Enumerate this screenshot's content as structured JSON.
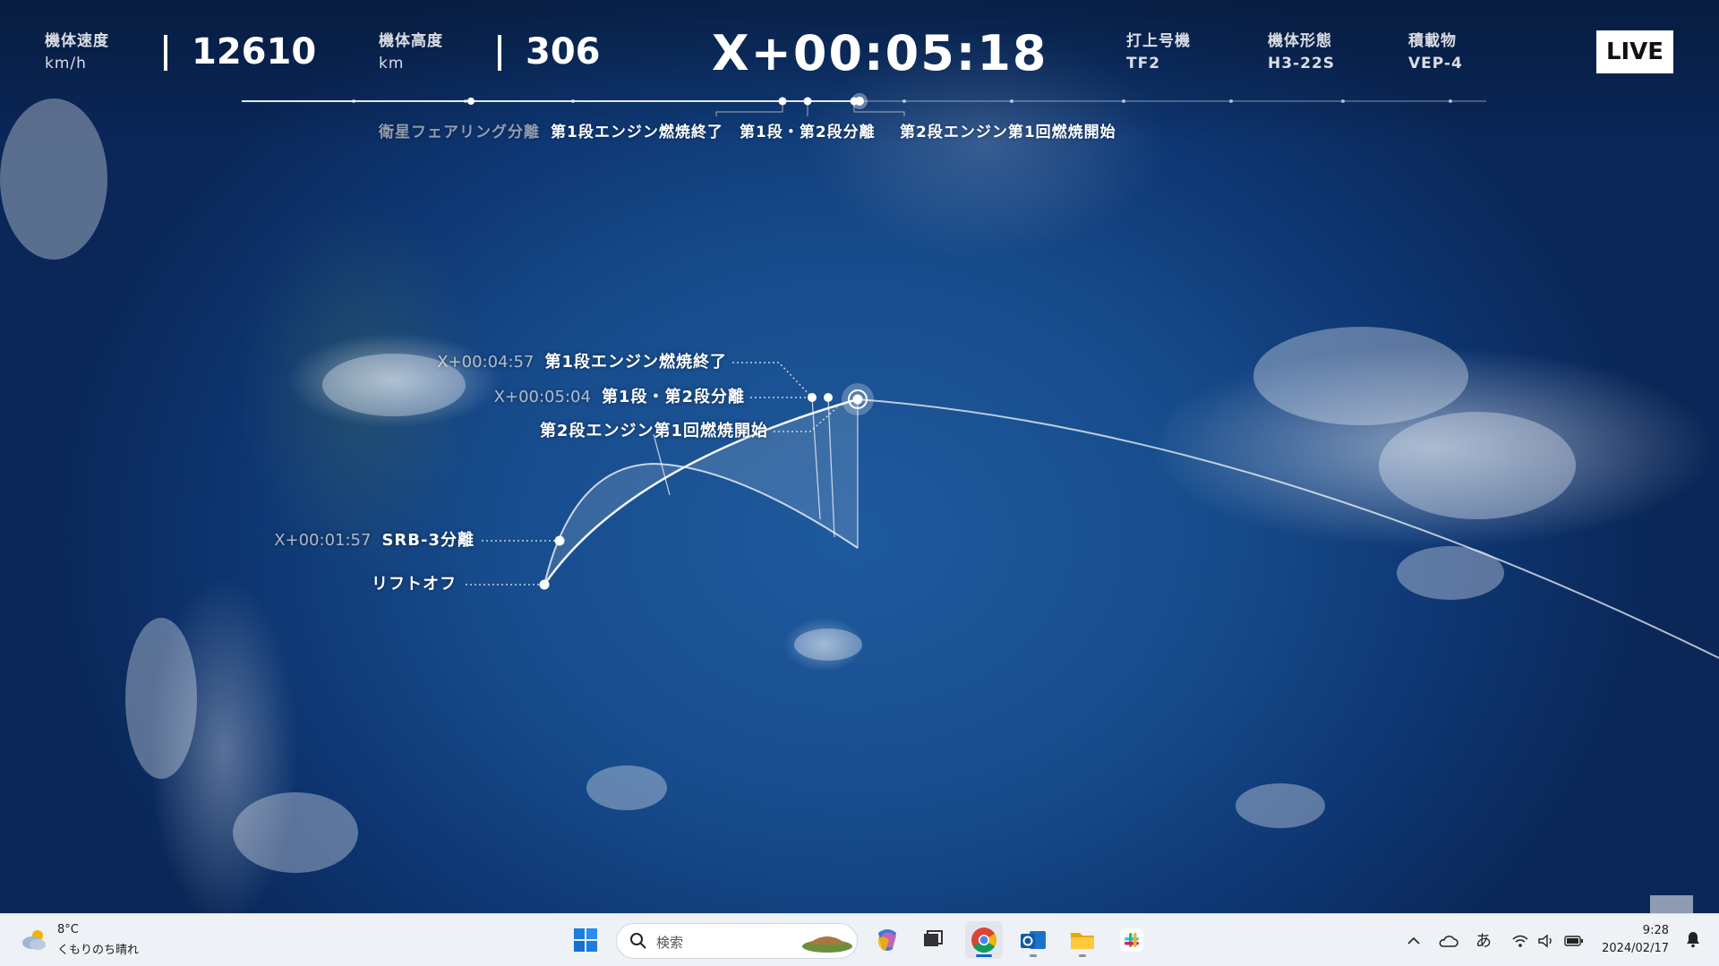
{
  "hud": {
    "speed": {
      "label": "機体速度",
      "unit": "km/h",
      "value": "12610"
    },
    "altitude": {
      "label": "機体高度",
      "unit": "km",
      "value": "306"
    },
    "timer": "X+00:05:18",
    "flight": {
      "label": "打上号機",
      "value": "TF2"
    },
    "vehicle": {
      "label": "機体形態",
      "value": "H3-22S"
    },
    "payload": {
      "label": "積載物",
      "value": "VEP-4"
    },
    "live": "LIVE"
  },
  "timeline": {
    "labels": [
      "衛星フェアリング分離",
      "第1段エンジン燃焼終了",
      "第1段・第2段分離",
      "第2段エンジン第1回燃焼開始"
    ]
  },
  "trajectory": {
    "events": [
      {
        "time": "X+00:04:57",
        "name": "第1段エンジン燃焼終了"
      },
      {
        "time": "X+00:05:04",
        "name": "第1段・第2段分離"
      },
      {
        "time": "",
        "name": "第2段エンジン第1回燃焼開始"
      },
      {
        "time": "X+00:01:57",
        "name": "SRB-3分離"
      },
      {
        "time": "",
        "name": "リフトオフ"
      }
    ]
  },
  "taskbar": {
    "weather": {
      "temp": "8°C",
      "desc": "くもりのち晴れ",
      "icon": "cloudy-sun-icon"
    },
    "search_placeholder": "検索",
    "apps": [
      "start-icon",
      "search-icon",
      "copilot-icon",
      "task-view-icon",
      "chrome-icon",
      "outlook-icon",
      "file-explorer-icon",
      "slack-icon"
    ],
    "ime": "あ",
    "time": "9:28",
    "date": "2024/02/17"
  }
}
